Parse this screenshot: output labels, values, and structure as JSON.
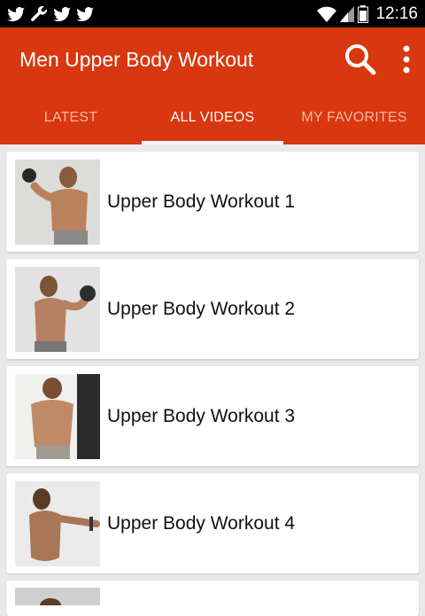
{
  "status_bar": {
    "time": "12:16",
    "left_icons": [
      "twitter-icon",
      "wrench-icon",
      "twitter-icon",
      "twitter-icon"
    ],
    "right_icons": [
      "wifi-icon",
      "signal-icon",
      "battery-icon"
    ]
  },
  "appbar": {
    "title": "Men Upper Body Workout",
    "color": "#d9370f"
  },
  "tabs": [
    {
      "label": "LATEST"
    },
    {
      "label": "ALL VIDEOS"
    },
    {
      "label": "MY FAVORITES"
    }
  ],
  "active_tab": "ALL VIDEOS",
  "videos": [
    {
      "title": "Upper Body Workout 1"
    },
    {
      "title": "Upper Body Workout 2"
    },
    {
      "title": "Upper Body Workout 3"
    },
    {
      "title": "Upper Body Workout 4"
    }
  ]
}
